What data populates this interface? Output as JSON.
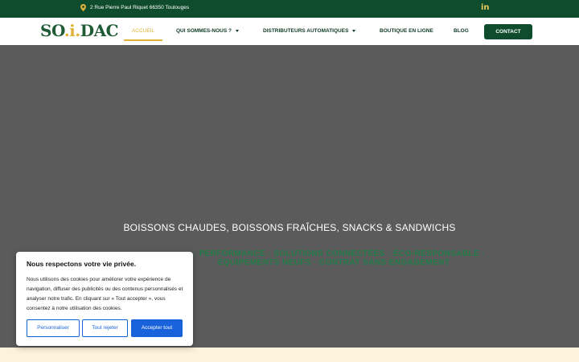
{
  "topbar": {
    "address": "2 Rue Pierre Paul Riquet 66350 Toulouges",
    "social_icon_label": "in"
  },
  "logo": {
    "part1": "SO",
    "dot": ".i.",
    "part2": "DAC"
  },
  "nav": {
    "items": [
      {
        "label": "ACCUEIL"
      },
      {
        "label": "QUI SOMMES-NOUS ?"
      },
      {
        "label": "DISTRIBUTEURS AUTOMATIQUES"
      },
      {
        "label": "BOUTIQUE EN LIGNE"
      },
      {
        "label": "BLOG"
      }
    ],
    "contact_label": "CONTACT"
  },
  "hero": {
    "title": "BOISSONS CHAUDES, BOISSONS FRAÎCHES, SNACKS & SANDWICHS",
    "subtitle": "… · PERFORMANCE · SOLUTIONS CONNECTÉES · ÉCO-RESPONSABLE · ÉQUIPEMENTS NEUFS · CONTRAT SANS ENGAGEMENT"
  },
  "cookie": {
    "title": "Nous respectons votre vie privée.",
    "body": "Nous utilisons des cookies pour améliorer votre expérience de navigation, diffuser des publicités ou des contenus personnalisés et analyser notre trafic. En cliquant sur « Tout accepter », vous consentez à notre utilisation des cookies.",
    "btn_customize": "Personnaliser",
    "btn_reject": "Tout rejeter",
    "btn_accept": "Accepter tout"
  },
  "colors": {
    "brand_green": "#0f4c2e",
    "accent_gold": "#e0b23a",
    "cookie_blue": "#1863dc"
  }
}
